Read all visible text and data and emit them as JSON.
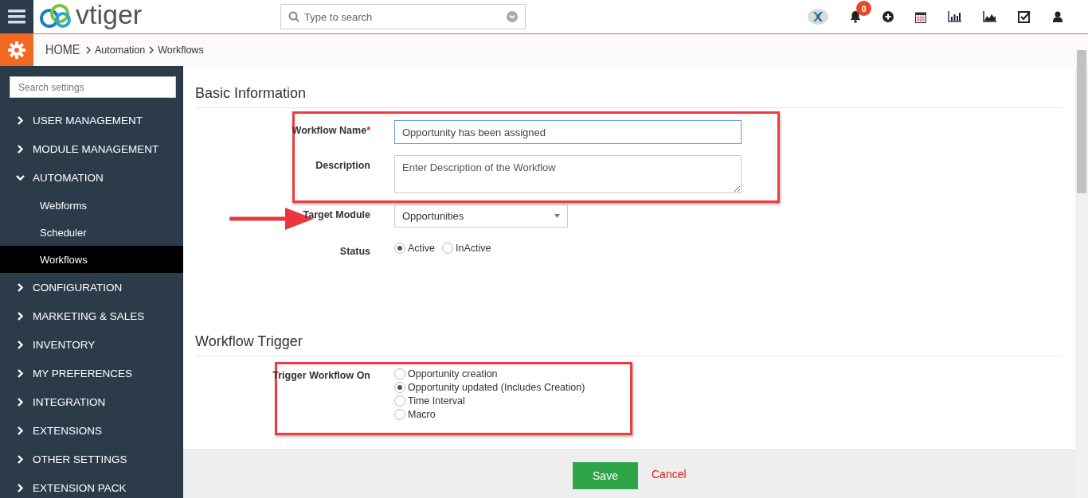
{
  "header": {
    "logo_text": "vtiger",
    "search": {
      "placeholder": "Type to search"
    },
    "notification_count": "0"
  },
  "breadcrumb": [
    {
      "label": "HOME",
      "kind": "home"
    },
    {
      "label": "Automation",
      "kind": "link"
    },
    {
      "label": "Workflows",
      "kind": "current"
    }
  ],
  "sidebar": {
    "search": {
      "placeholder": "Search settings"
    },
    "items": [
      {
        "label": "USER MANAGEMENT",
        "expanded": false
      },
      {
        "label": "MODULE MANAGEMENT",
        "expanded": false
      },
      {
        "label": "AUTOMATION",
        "expanded": true,
        "children": [
          {
            "label": "Webforms",
            "selected": false
          },
          {
            "label": "Scheduler",
            "selected": false
          },
          {
            "label": "Workflows",
            "selected": true
          }
        ]
      },
      {
        "label": "CONFIGURATION",
        "expanded": false
      },
      {
        "label": "MARKETING & SALES",
        "expanded": false
      },
      {
        "label": "INVENTORY",
        "expanded": false
      },
      {
        "label": "MY PREFERENCES",
        "expanded": false
      },
      {
        "label": "INTEGRATION",
        "expanded": false
      },
      {
        "label": "EXTENSIONS",
        "expanded": false
      },
      {
        "label": "OTHER SETTINGS",
        "expanded": false
      },
      {
        "label": "EXTENSION PACK",
        "expanded": false
      }
    ]
  },
  "basic_information": {
    "title": "Basic Information",
    "workflow_name": {
      "label": "Workflow Name",
      "required_mark": "*",
      "value": "Opportunity has been assigned"
    },
    "description": {
      "label": "Description",
      "placeholder": "Enter Description of the Workflow"
    },
    "target_module": {
      "label": "Target Module",
      "value": "Opportunities"
    },
    "status": {
      "label": "Status",
      "options": [
        {
          "label": "Active",
          "selected": true
        },
        {
          "label": "InActive",
          "selected": false
        }
      ]
    }
  },
  "workflow_trigger": {
    "title": "Workflow Trigger",
    "label": "Trigger Workflow On",
    "options": [
      {
        "label": "Opportunity creation",
        "selected": false
      },
      {
        "label": "Opportunity updated  (Includes Creation)",
        "selected": true
      },
      {
        "label": "Time Interval",
        "selected": false
      },
      {
        "label": "Macro",
        "selected": false
      }
    ]
  },
  "footer": {
    "save": "Save",
    "cancel": "Cancel"
  }
}
